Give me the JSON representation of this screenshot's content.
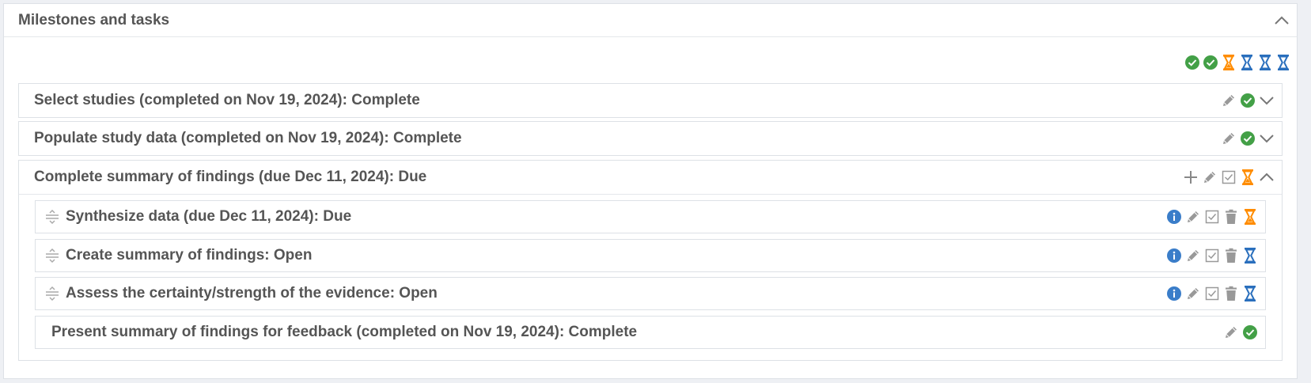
{
  "panel": {
    "title": "Milestones and tasks"
  },
  "summary_icons": [
    "check-circle-icon",
    "check-circle-icon",
    "hourglass-icon",
    "hourglass-icon",
    "hourglass-icon",
    "hourglass-icon"
  ],
  "colors": {
    "complete": "#43a047",
    "due": "#ff8c00",
    "open": "#2a6fbd",
    "info": "#3a7dc9",
    "muted": "#999999"
  },
  "milestones": [
    {
      "label": "Select studies (completed on Nov 19, 2024): Complete",
      "status": "complete"
    },
    {
      "label": "Populate study data (completed on Nov 19, 2024): Complete",
      "status": "complete"
    },
    {
      "label": "Complete summary of findings (due Dec 11, 2024): Due",
      "status": "due",
      "tasks": [
        {
          "label": "Synthesize data (due Dec 11, 2024): Due",
          "status": "due"
        },
        {
          "label": "Create summary of findings: Open",
          "status": "open"
        },
        {
          "label": "Assess the certainty/strength of the evidence: Open",
          "status": "open"
        },
        {
          "label": "Present summary of findings for feedback (completed on Nov 19, 2024): Complete",
          "status": "complete"
        }
      ]
    }
  ]
}
